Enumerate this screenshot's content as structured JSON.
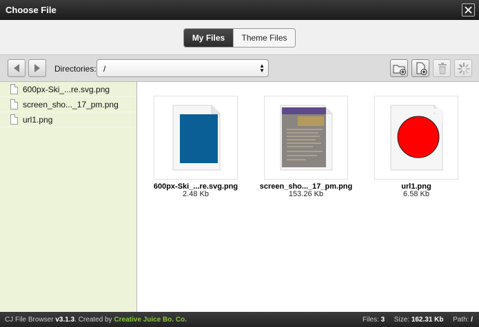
{
  "window": {
    "title": "Choose File",
    "close_icon": "close-icon"
  },
  "tabs": [
    {
      "label": "My Files",
      "active": true
    },
    {
      "label": "Theme Files",
      "active": false
    }
  ],
  "toolbar": {
    "back_icon": "arrow-left-icon",
    "forward_icon": "arrow-right-icon",
    "directories_label": "Directories:",
    "directory_value": "/",
    "actions": [
      {
        "name": "new-folder",
        "icon": "folder-add-icon"
      },
      {
        "name": "upload-file",
        "icon": "file-add-icon"
      },
      {
        "name": "delete",
        "icon": "trash-icon"
      },
      {
        "name": "refresh",
        "icon": "spinner-icon"
      }
    ]
  },
  "sidebar": {
    "files": [
      {
        "name": "600px-Ski_...re.svg.png"
      },
      {
        "name": "screen_sho..._17_pm.png"
      },
      {
        "name": "url1.png"
      }
    ]
  },
  "main": {
    "thumbnails": [
      {
        "name": "600px-Ski_...re.svg.png",
        "size": "2.48 Kb",
        "preview_color": "#0a5f96"
      },
      {
        "name": "screen_sho..._17_pm.png",
        "size": "153.26 Kb",
        "preview_color": "#8a8580"
      },
      {
        "name": "url1.png",
        "size": "6.58 Kb",
        "preview_color": "#ff0000"
      }
    ]
  },
  "status": {
    "app_name": "CJ File Browser",
    "version": "v3.1.3",
    "created_by": ". Created by",
    "author": "Creative Juice Bo. Co.",
    "files_label": "Files:",
    "files_count": "3",
    "size_label": "Size:",
    "size_value": "162.31 Kb",
    "path_label": "Path:",
    "path_value": "/"
  }
}
